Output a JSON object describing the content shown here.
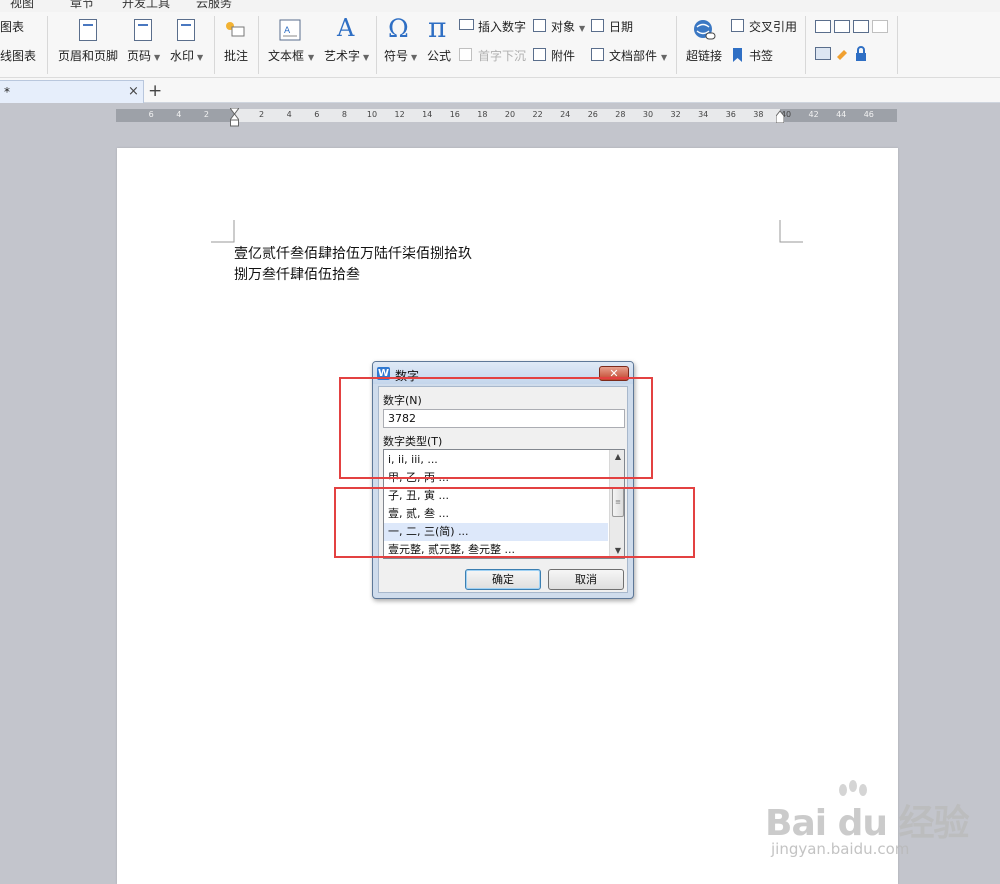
{
  "menu": {
    "items": [
      "视图",
      "章节",
      "开发工具",
      "云服务"
    ]
  },
  "ribbon": {
    "chart": "图表",
    "online_chart": "在线图表",
    "header_footer": "页眉和页脚",
    "page_number": "页码",
    "watermark": "水印",
    "comment": "批注",
    "textbox": "文本框",
    "wordart": "艺术字",
    "symbol": "符号",
    "formula": "公式",
    "insert_number": "插入数字",
    "object": "对象",
    "date": "日期",
    "drop_cap": "首字下沉",
    "attachment": "附件",
    "doc_parts": "文档部件",
    "hyperlink": "超链接",
    "cross_ref": "交叉引用",
    "bookmark": "书签",
    "symbol_glyph": "Ω",
    "formula_glyph": "π",
    "wordart_glyph": "A"
  },
  "tabs": {
    "doc_tab_title": "*",
    "close_glyph": "×",
    "new_tab_glyph": "+"
  },
  "ruler": {
    "left_ticks": [
      "6",
      "4",
      "2"
    ],
    "ticks": [
      "2",
      "4",
      "6",
      "8",
      "10",
      "12",
      "14",
      "16",
      "18",
      "20",
      "22",
      "24",
      "26",
      "28",
      "30",
      "32",
      "34",
      "36",
      "38",
      "40"
    ],
    "right_ticks": [
      "42",
      "44",
      "46"
    ]
  },
  "document": {
    "line1": "壹亿贰仟叁佰肆拾伍万陆仟柒佰捌拾玖",
    "line2": "捌万叁仟肆佰伍拾叁"
  },
  "dialog": {
    "title": "数字",
    "app_icon_letter": "W",
    "close_glyph": "✕",
    "number_label": "数字(N)",
    "number_value": "3782",
    "type_label": "数字类型(T)",
    "types": [
      "i, ii, iii, ...",
      "甲, 乙, 丙 ...",
      "子, 丑, 寅 ...",
      "壹, 贰, 叁 ...",
      "一, 二, 三(简) ...",
      "壹元整, 贰元整, 叁元整 ..."
    ],
    "selected_index": 4,
    "scroll_up": "▲",
    "scroll_down": "▼",
    "ok": "确定",
    "cancel": "取消"
  },
  "watermark": {
    "brand": "Bai du 经验",
    "url": "jingyan.baidu.com"
  },
  "colors": {
    "highlight": "#e34141",
    "accent": "#2f6fc4",
    "selection": "#dde8fa"
  }
}
